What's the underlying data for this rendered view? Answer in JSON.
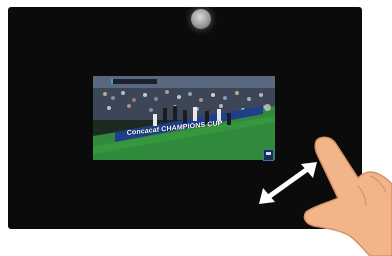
{
  "video": {
    "banner_text": "Concacaf CHAMPIONS CUP",
    "scorebug_tag": "",
    "scorebug_text": ""
  },
  "icons": {
    "camera": "front-camera-icon",
    "resize": "diagonal-resize-arrow-icon",
    "gesture": "pointing-hand-icon"
  },
  "colors": {
    "screen": "#0b0b0b",
    "pitch": "#2f8a3c",
    "banner": "#ffffff",
    "skin": "#f2b58a"
  }
}
